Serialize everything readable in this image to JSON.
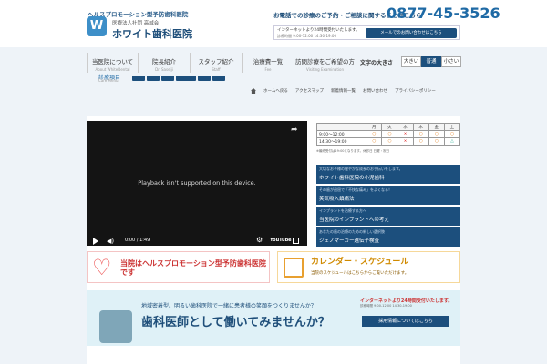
{
  "header": {
    "tagline": "ヘルスプロモーション型予防歯科医院",
    "logo_glyph": "W",
    "corp": "医療法人社団 高誠会",
    "clinic_name": "ホワイト歯科医院",
    "phone_lead": "お電話での診療のご予約・ご相談に関することはこちら",
    "phone": "0877-45-3526",
    "web_note": "インターネットより24時間受付いたします。",
    "web_hours": "診療時間 9:00-12:00 14:30-19:00",
    "web_button": "メールでのお問い合わせはこちら"
  },
  "nav": [
    {
      "jp": "当医院について",
      "en": "About WhiteDental"
    },
    {
      "jp": "院長紹介",
      "en": "Dr. Saseiji"
    },
    {
      "jp": "スタッフ紹介",
      "en": "Staff"
    },
    {
      "jp": "治療費一覧",
      "en": "Fee"
    },
    {
      "jp": "訪問診療をご希望の方",
      "en": "Visiting Examination"
    }
  ],
  "text_size": {
    "label": "文字の大きさ",
    "options": [
      "大きい",
      "普通",
      "小さい"
    ],
    "selected": "普通"
  },
  "subnav": {
    "label": "診療項目",
    "en": "Care Menu"
  },
  "breadcrumbs": [
    "ホームへ戻る",
    "アクセスマップ",
    "新着情報一覧",
    "お問い合わせ",
    "プライバシーポリシー"
  ],
  "video": {
    "message": "Playback isn't supported on this device.",
    "time": "0:00 / 1:49",
    "logo": "YouTube"
  },
  "schedule": {
    "headers": [
      "",
      "月",
      "火",
      "水",
      "木",
      "金",
      "土"
    ],
    "rows": [
      {
        "time": "9:00〜12:00",
        "marks": [
          "○",
          "○",
          "×",
          "○",
          "○",
          "○"
        ]
      },
      {
        "time": "14:30〜19:00",
        "marks": [
          "○",
          "○",
          "×",
          "○",
          "○",
          "△"
        ]
      }
    ],
    "note": "※最終受付は19:00となります。休診日 日曜・祝日"
  },
  "side_buttons": [
    {
      "sub": "大切なお子様の健やかな成長のお手伝いをします。",
      "main": "ホワイト歯科医院の小児歯科"
    },
    {
      "sub": "その歯が退屈で「不快な痛み」をよくなる！",
      "main": "笑気吸入鎮痛法"
    },
    {
      "sub": "インプラントを治療する方へ",
      "main": "当医院のインプラントへの考え"
    },
    {
      "sub": "あなたの歯の治療のための新しい選択肢",
      "main": "ジェノマーカー遺伝子検査"
    }
  ],
  "banners": {
    "left_main": "当院はヘルスプロモーション型予防歯科医院です",
    "right_main": "カレンダー・スケジュール",
    "right_sub": "当院のスケジュールはこちらからご覧いただけます。"
  },
  "recruit": {
    "question": "地域密着型。明るい歯科医院で一緒に患者様の笑顔をつくりませんか？",
    "main": "歯科医師として働いてみませんか？",
    "lead": "インターネットより24時間受付いたします。",
    "hours": "診療時間 9:00-12:00 14:30-19:00",
    "button": "採用情報についてはこちら"
  }
}
